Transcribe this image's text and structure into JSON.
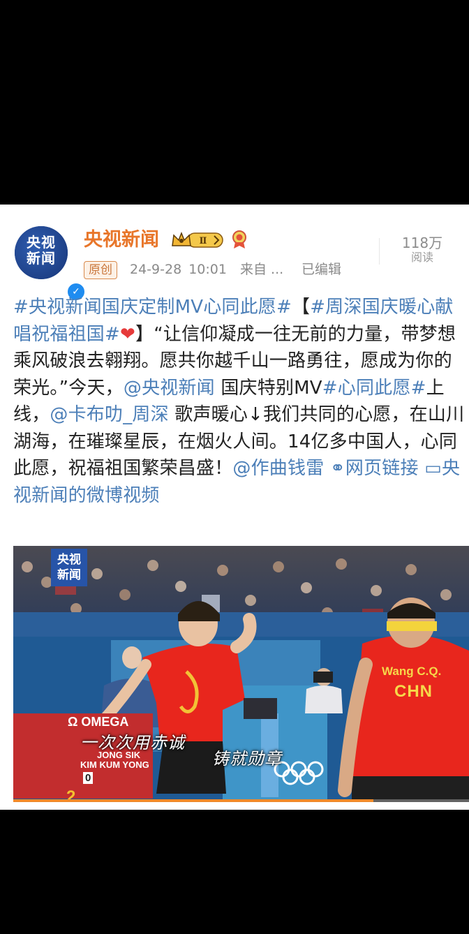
{
  "post": {
    "avatar_line1": "央视",
    "avatar_line2": "新闻",
    "username": "央视新闻",
    "vip_level": "Ⅱ",
    "original_tag": "原创",
    "timestamp": "24-9-28 10:01",
    "source": "来自 ...",
    "edited": "已编辑",
    "reads_count": "118万",
    "reads_label": "阅读"
  },
  "content": {
    "topic1": "#央视新闻国庆定制MV心同此愿#",
    "bracket_open": "【",
    "topic2": "#周深国庆暖心献唱祝福祖国#",
    "heart": "❤",
    "text1": "】“让信仰凝成一往无前的力量，带梦想乘风破浪去翱翔。愿共你越千山一路勇往，愿成为你的荣光。”今天，",
    "mention1": "@央视新闻",
    "text2": " 国庆特别MV",
    "topic3": "#心同此愿#",
    "text3": "上线，",
    "mention2": "@卡布叻_周深",
    "text4": " 歌声暖心↓我们共同的心愿，在山川湖海，在璀璨星辰，在烟火人间。14亿多中国人，心同此愿，祝福祖国繁荣昌盛！",
    "mention3": "@作曲钱雷",
    "link_web": "网页链接",
    "link_video": "央视新闻的微博视频"
  },
  "video": {
    "channel_badge_line1": "央视",
    "channel_badge_line2": "新闻",
    "scoreboard_brand": "Ω OMEGA",
    "scoreboard_name1": "JONG SIK",
    "scoreboard_name2": "KIM KUM YONG",
    "scoreboard_score1": "0",
    "scoreboard_score2": "2",
    "caption1": "一次次用赤诚",
    "caption2": "铸就勋章",
    "jersey_name": "Wang C.Q.",
    "jersey_country": "CHN",
    "progress": 0.79
  },
  "colors": {
    "link": "#4c7fb8",
    "username": "#e8762a",
    "progress": "#f08a2a"
  }
}
